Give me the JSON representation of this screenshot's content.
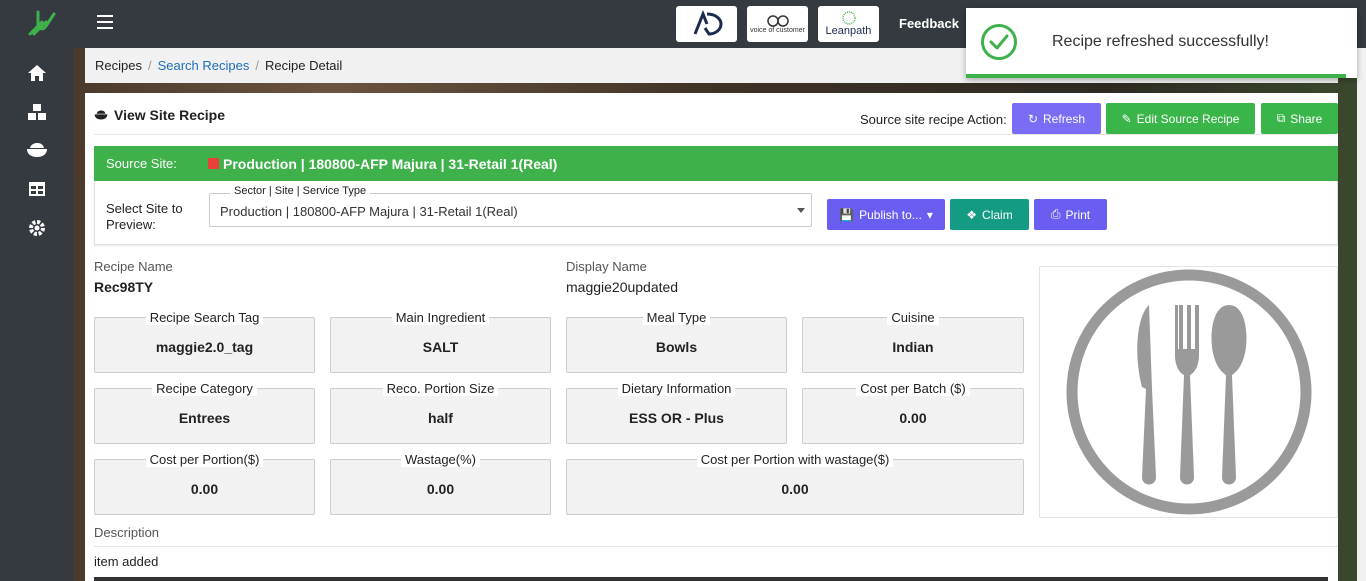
{
  "sidebar": {
    "items": [
      {
        "icon": "home-icon"
      },
      {
        "icon": "boxes-icon"
      },
      {
        "icon": "bowl-icon"
      },
      {
        "icon": "table-icon"
      },
      {
        "icon": "gear-icon"
      }
    ]
  },
  "topbar": {
    "brands": [
      "AD",
      "voice of customer",
      "Leanpath"
    ],
    "feedback_label": "Feedback"
  },
  "breadcrumb": {
    "root": "Recipes",
    "middle": "Search Recipes",
    "current": "Recipe Detail"
  },
  "card": {
    "title": "View Site Recipe",
    "action_label": "Source site recipe Action:",
    "buttons": {
      "refresh": "Refresh",
      "edit": "Edit Source Recipe",
      "share": "Share"
    }
  },
  "source": {
    "label": "Source Site:",
    "value": "Production | 180800-AFP Majura | 31-Retail 1(Real)"
  },
  "preview": {
    "label": "Select Site to Preview:",
    "legend": "Sector | Site | Service Type",
    "value": "Production | 180800-AFP Majura | 31-Retail 1(Real)",
    "publish": "Publish to...",
    "claim": "Claim",
    "print": "Print"
  },
  "recipe": {
    "name_label": "Recipe Name",
    "name": "Rec98TY",
    "display_label": "Display Name",
    "display": "maggie20updated",
    "fields": [
      {
        "label": "Recipe Search Tag",
        "value": "maggie2.0_tag"
      },
      {
        "label": "Main Ingredient",
        "value": "SALT"
      },
      {
        "label": "Meal Type",
        "value": "Bowls"
      },
      {
        "label": "Cuisine",
        "value": "Indian"
      },
      {
        "label": "Recipe Category",
        "value": "Entrees"
      },
      {
        "label": "Reco. Portion Size",
        "value": "half"
      },
      {
        "label": "Dietary Information",
        "value": "ESS OR - Plus"
      },
      {
        "label": "Cost per Batch ($)",
        "value": "0.00"
      },
      {
        "label": "Cost per Portion($)",
        "value": "0.00"
      },
      {
        "label": "Wastage(%)",
        "value": "0.00"
      },
      {
        "label": "Cost per Portion with wastage($)",
        "value": "0.00"
      }
    ],
    "description_label": "Description",
    "description": "item added"
  },
  "toast": {
    "message": "Recipe refreshed successfully!"
  },
  "colors": {
    "sidebar": "#343a40",
    "source_green": "#3eb14b",
    "refresh_purple": "#7b6cf6",
    "claim_teal": "#139c83",
    "link_blue": "#1e6dbf"
  }
}
